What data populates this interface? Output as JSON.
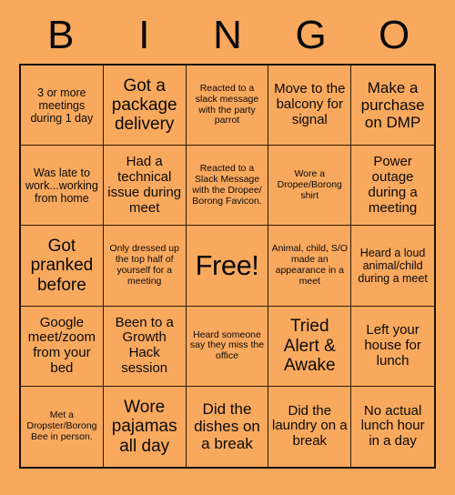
{
  "card": {
    "title_letters": [
      "B",
      "I",
      "N",
      "G",
      "O"
    ],
    "colors": {
      "background": "#f9a95e",
      "cell_background": "#f9a95e",
      "border": "#1a1206",
      "text": "#0a0a0a"
    },
    "rows": [
      [
        {
          "text": "3 or more meetings during 1 day",
          "size": "sm"
        },
        {
          "text": "Got a package delivery",
          "size": "xl"
        },
        {
          "text": "Reacted to a slack message with the party parrot",
          "size": "xs"
        },
        {
          "text": "Move to the balcony for signal",
          "size": "md"
        },
        {
          "text": "Make a purchase on DMP",
          "size": "lg"
        }
      ],
      [
        {
          "text": "Was late to work...working from home",
          "size": "sm"
        },
        {
          "text": "Had a technical issue during meet",
          "size": "md"
        },
        {
          "text": "Reacted to a Slack Message with the Dropee/ Borong Favicon.",
          "size": "xs"
        },
        {
          "text": "Wore a Dropee/Borong shirt",
          "size": "xs"
        },
        {
          "text": "Power outage during a meeting",
          "size": "md"
        }
      ],
      [
        {
          "text": "Got pranked before",
          "size": "xl"
        },
        {
          "text": "Only dressed up the top half of yourself for a meeting",
          "size": "xs"
        },
        {
          "text": "Free!",
          "size": "free"
        },
        {
          "text": "Animal, child, S/O made an appearance in a meet",
          "size": "xs"
        },
        {
          "text": "Heard a loud animal/child during a meet",
          "size": "sm"
        }
      ],
      [
        {
          "text": "Google meet/zoom from your bed",
          "size": "md"
        },
        {
          "text": "Been to a Growth Hack session",
          "size": "md"
        },
        {
          "text": "Heard someone say they miss the office",
          "size": "xs"
        },
        {
          "text": "Tried Alert & Awake",
          "size": "xl"
        },
        {
          "text": "Left your house for lunch",
          "size": "md"
        }
      ],
      [
        {
          "text": "Met a Dropster/Borong Bee in person.",
          "size": "xs"
        },
        {
          "text": "Wore pajamas all day",
          "size": "xl"
        },
        {
          "text": "Did the dishes on a break",
          "size": "lg"
        },
        {
          "text": "Did the laundry on a break",
          "size": "md"
        },
        {
          "text": "No actual lunch hour in a day",
          "size": "md"
        }
      ]
    ]
  }
}
